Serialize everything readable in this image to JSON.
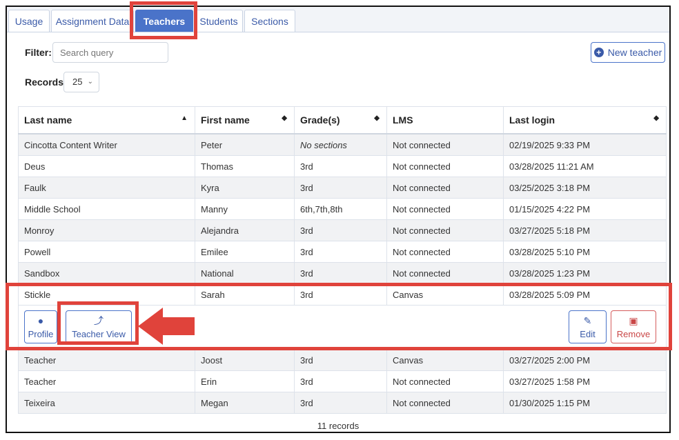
{
  "tabs": [
    {
      "label": "Usage"
    },
    {
      "label": "Assignment Data"
    },
    {
      "label": "Teachers",
      "active": true
    },
    {
      "label": "Students"
    },
    {
      "label": "Sections"
    }
  ],
  "filter": {
    "label": "Filter:",
    "placeholder": "Search query"
  },
  "records": {
    "label": "Records:",
    "value": "25"
  },
  "new_teacher_label": "New teacher",
  "table": {
    "headers": [
      "Last name",
      "First name",
      "Grade(s)",
      "LMS",
      "Last login"
    ],
    "rows_top": [
      [
        "Cincotta Content Writer",
        "Peter",
        "No sections",
        "Not connected",
        "02/19/2025 9:33 PM"
      ],
      [
        "Deus",
        "Thomas",
        "3rd",
        "Not connected",
        "03/28/2025 11:21 AM"
      ],
      [
        "Faulk",
        "Kyra",
        "3rd",
        "Not connected",
        "03/25/2025 3:18 PM"
      ],
      [
        "Middle School",
        "Manny",
        "6th,7th,8th",
        "Not connected",
        "01/15/2025 4:22 PM"
      ],
      [
        "Monroy",
        "Alejandra",
        "3rd",
        "Not connected",
        "03/27/2025 5:18 PM"
      ],
      [
        "Powell",
        "Emilee",
        "3rd",
        "Not connected",
        "03/28/2025 5:10 PM"
      ],
      [
        "Sandbox",
        "National",
        "3rd",
        "Not connected",
        "03/28/2025 1:23 PM"
      ],
      [
        "Stickle",
        "Sarah",
        "3rd",
        "Canvas",
        "03/28/2025 5:09 PM"
      ]
    ],
    "rows_bottom": [
      [
        "Teacher",
        "Joost",
        "3rd",
        "Canvas",
        "03/27/2025 2:00 PM"
      ],
      [
        "Teacher",
        "Erin",
        "3rd",
        "Not connected",
        "03/27/2025 1:58 PM"
      ],
      [
        "Teixeira",
        "Megan",
        "3rd",
        "Not connected",
        "01/30/2025 1:15 PM"
      ]
    ]
  },
  "actions": {
    "profile": "Profile",
    "teacher_view": "Teacher View",
    "edit": "Edit",
    "remove": "Remove"
  },
  "footer_text": "11 records",
  "colors": {
    "accent": "#4a73c9",
    "highlight": "#e0433b",
    "danger": "#c94646"
  }
}
